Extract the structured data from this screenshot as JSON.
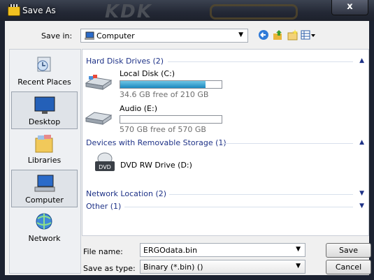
{
  "title": "Save As",
  "close_label": "x",
  "title_art": "KDK",
  "save_in": {
    "label": "Save in:",
    "value": "Computer"
  },
  "toolbar": {
    "back_icon": "back-arrow-icon",
    "up_icon": "up-folder-icon",
    "new_folder_icon": "new-folder-icon",
    "views_icon": "views-menu-icon"
  },
  "places": [
    {
      "label": "Recent Places",
      "icon": "recent-places-icon"
    },
    {
      "label": "Desktop",
      "icon": "desktop-icon"
    },
    {
      "label": "Libraries",
      "icon": "libraries-icon"
    },
    {
      "label": "Computer",
      "icon": "computer-icon"
    },
    {
      "label": "Network",
      "icon": "network-icon"
    }
  ],
  "groups": {
    "hdd": {
      "title": "Hard Disk Drives (2)",
      "drives": [
        {
          "name": "Local Disk (C:)",
          "free": "34.6 GB free of 210 GB",
          "used_fraction": 0.84
        },
        {
          "name": "Audio (E:)",
          "free": "570 GB free of 570 GB",
          "used_fraction": 0.0
        }
      ]
    },
    "removable": {
      "title": "Devices with Removable Storage (1)",
      "drive": {
        "name": "DVD RW Drive (D:)",
        "badge": "DVD"
      }
    },
    "network": {
      "title": "Network Location (2)"
    },
    "other": {
      "title": "Other (1)"
    }
  },
  "file_name": {
    "label": "File name:",
    "value": "ERGOdata.bin"
  },
  "file_type": {
    "label": "Save as type:",
    "value": "Binary (*.bin) ()"
  },
  "buttons": {
    "save": "Save",
    "cancel": "Cancel"
  },
  "colors": {
    "group_header": "#1e3287",
    "progress_fill": "#1b88bf",
    "title_bar": "#232835"
  }
}
